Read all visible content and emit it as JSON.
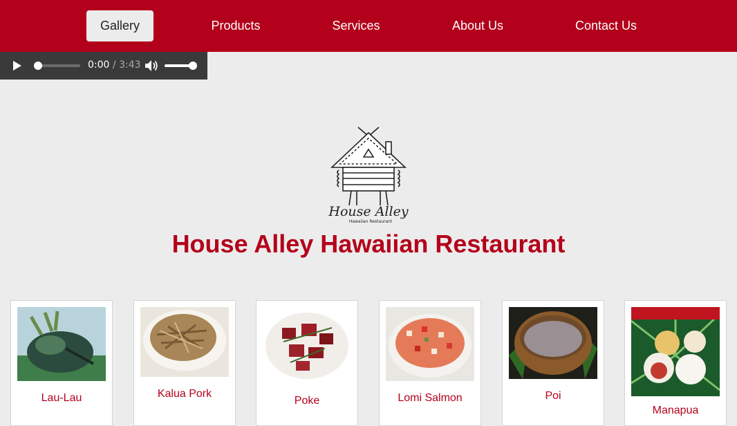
{
  "nav": {
    "items": [
      {
        "label": "Gallery",
        "active": true
      },
      {
        "label": "Products",
        "active": false
      },
      {
        "label": "Services",
        "active": false
      },
      {
        "label": "About Us",
        "active": false
      },
      {
        "label": "Contact Us",
        "active": false
      }
    ]
  },
  "audio": {
    "current_time": "0:00",
    "duration": "/ 3:43",
    "progress": 0,
    "volume": 1,
    "icons": [
      "play-icon",
      "volume-icon"
    ]
  },
  "logo": {
    "alt": "House Alley logo",
    "script_text": "House Alley",
    "sub_text": "Hawaiian Restaurant"
  },
  "page_title": "House Alley Hawaiian Restaurant",
  "gallery": [
    {
      "label": "Lau-Lau"
    },
    {
      "label": "Kalua Pork"
    },
    {
      "label": "Poke"
    },
    {
      "label": "Lomi Salmon"
    },
    {
      "label": "Poi"
    },
    {
      "label": "Manapua"
    }
  ],
  "colors": {
    "brand": "#b3001b",
    "background": "#ececec",
    "active_nav": "#ececec",
    "player": "#3a3a3a"
  }
}
